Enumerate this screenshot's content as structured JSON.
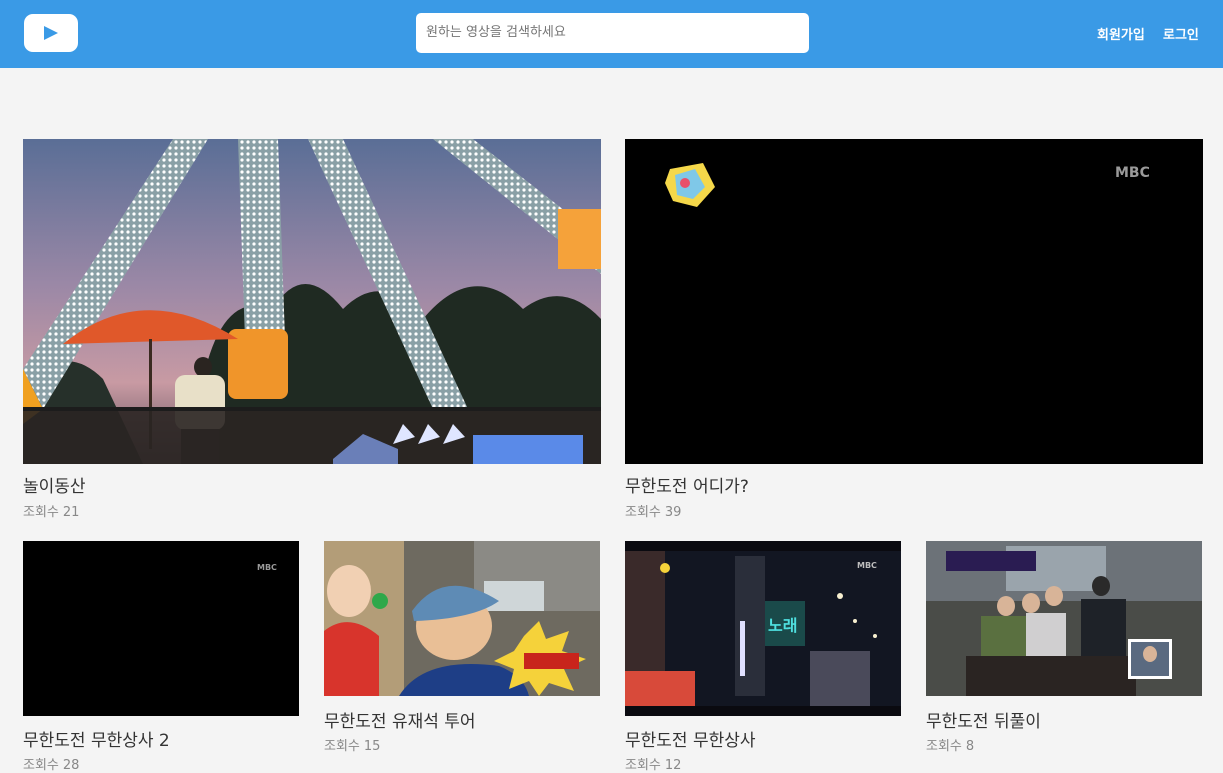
{
  "header": {
    "logo_icon": "play-icon",
    "search_placeholder": "원하는 영상을 검색하세요",
    "signup_label": "회원가입",
    "login_label": "로그인"
  },
  "colors": {
    "header_bg": "#3a9ae6",
    "page_bg": "#f4f4f4"
  },
  "videos": [
    {
      "title": "놀이동산",
      "views_label": "조회수",
      "views": "21",
      "thumbnail": "amusement-park-ride-at-dusk"
    },
    {
      "title": "무한도전 어디가?",
      "views_label": "조회수",
      "views": "39",
      "thumbnail": "black-screen-mbc",
      "overlay_text": "MBC"
    },
    {
      "title": "무한도전 무한상사 2",
      "views_label": "조회수",
      "views": "28",
      "thumbnail": "black-screen-mbc",
      "overlay_text": "MBC"
    },
    {
      "title": "무한도전 유재석 투어",
      "views_label": "조회수",
      "views": "15",
      "thumbnail": "two-men-eating-caption"
    },
    {
      "title": "무한도전 무한상사",
      "views_label": "조회수",
      "views": "12",
      "thumbnail": "night-street-neon-signs",
      "overlay_text": "MBC"
    },
    {
      "title": "무한도전 뒤풀이",
      "views_label": "조회수",
      "views": "8",
      "thumbnail": "group-dinner-restaurant"
    }
  ]
}
